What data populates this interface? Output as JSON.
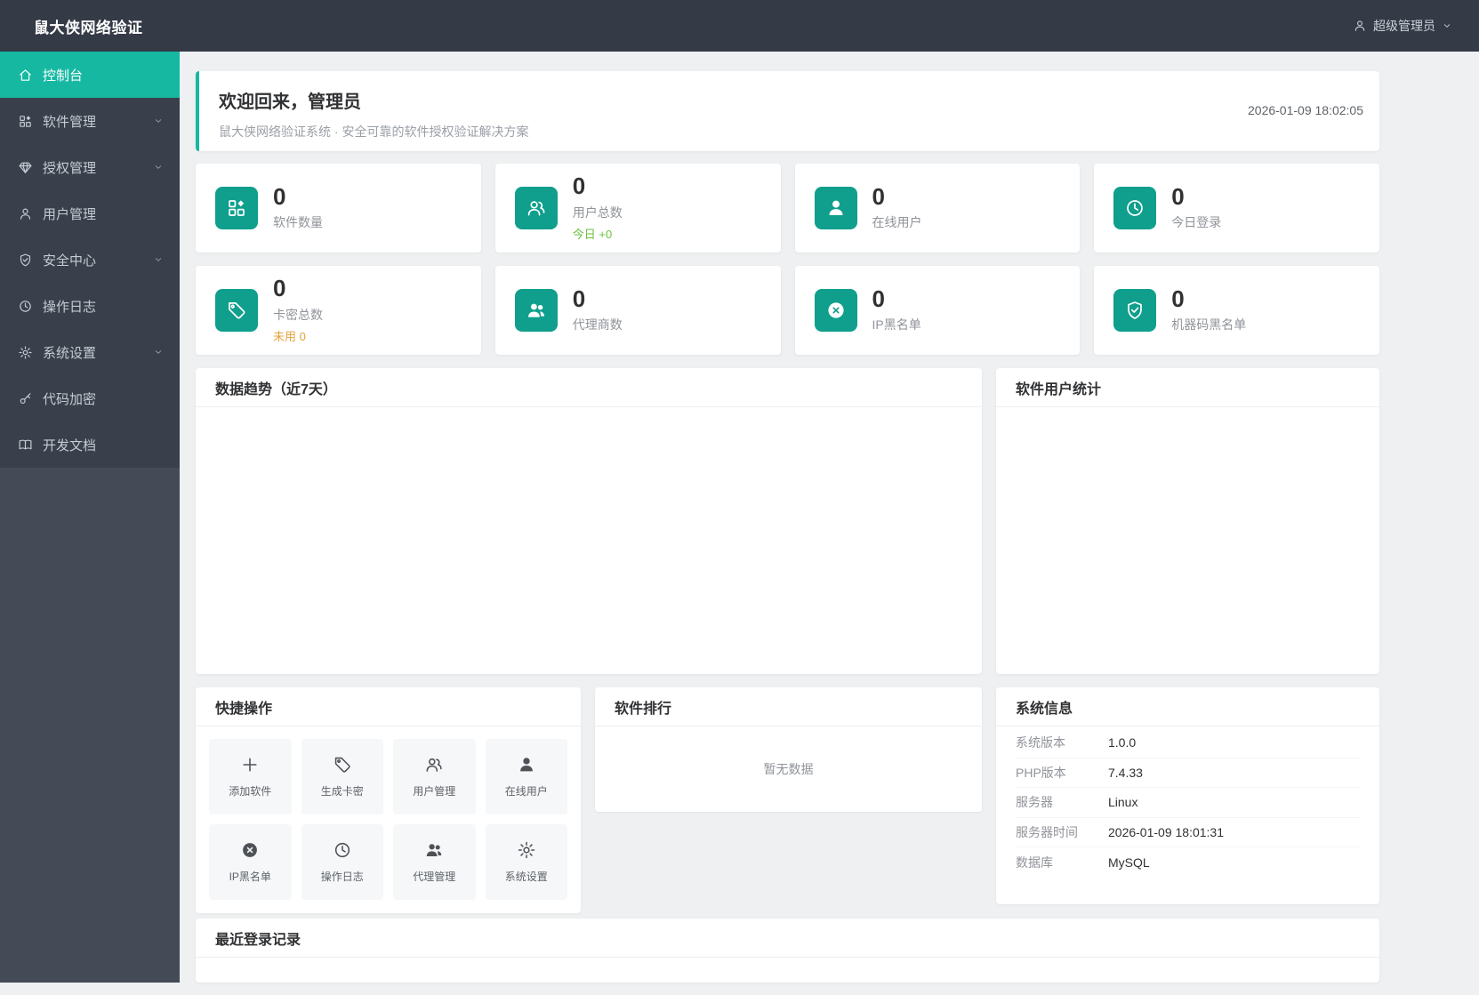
{
  "app": {
    "title": "鼠大侠网络验证"
  },
  "topbar": {
    "user": "超级管理员"
  },
  "colors": {
    "accent": "#16b8a2",
    "tile": "#0f9f8c",
    "success": "#67c23a",
    "warning": "#e6a23c",
    "topbar": "#343a46",
    "sidebar": "#39404b",
    "sidebar_lower": "#444a56"
  },
  "sidebar": {
    "items": [
      {
        "label": "控制台",
        "icon": "home",
        "active": true,
        "expandable": false
      },
      {
        "label": "软件管理",
        "icon": "apps",
        "active": false,
        "expandable": true
      },
      {
        "label": "授权管理",
        "icon": "diamond",
        "active": false,
        "expandable": true
      },
      {
        "label": "用户管理",
        "icon": "user",
        "active": false,
        "expandable": false
      },
      {
        "label": "安全中心",
        "icon": "shield-check",
        "active": false,
        "expandable": true
      },
      {
        "label": "操作日志",
        "icon": "clock",
        "active": false,
        "expandable": false
      },
      {
        "label": "系统设置",
        "icon": "gear",
        "active": false,
        "expandable": true
      },
      {
        "label": "代码加密",
        "icon": "key",
        "active": false,
        "expandable": false
      },
      {
        "label": "开发文档",
        "icon": "book",
        "active": false,
        "expandable": false
      }
    ]
  },
  "welcome": {
    "title": "欢迎回来，管理员",
    "subtitle": "鼠大侠网络验证系统 · 安全可靠的软件授权验证解决方案",
    "datetime": "2026-01-09 18:02:05"
  },
  "stats": [
    {
      "icon": "apps",
      "value": "0",
      "label": "软件数量"
    },
    {
      "icon": "users",
      "value": "0",
      "label": "用户总数",
      "sub": "今日 +0",
      "sub_type": "success"
    },
    {
      "icon": "user-solid",
      "value": "0",
      "label": "在线用户"
    },
    {
      "icon": "clock",
      "value": "0",
      "label": "今日登录"
    },
    {
      "icon": "tag",
      "value": "0",
      "label": "卡密总数",
      "sub": "未用 0",
      "sub_type": "warning"
    },
    {
      "icon": "users-solid",
      "value": "0",
      "label": "代理商数"
    },
    {
      "icon": "circle-x",
      "value": "0",
      "label": "IP黑名单"
    },
    {
      "icon": "shield-check",
      "value": "0",
      "label": "机器码黑名单"
    }
  ],
  "panels": {
    "trend": {
      "title": "数据趋势（近7天）"
    },
    "software_users": {
      "title": "软件用户统计"
    },
    "quick_actions": {
      "title": "快捷操作",
      "items": [
        {
          "icon": "plus",
          "label": "添加软件"
        },
        {
          "icon": "tag",
          "label": "生成卡密"
        },
        {
          "icon": "users",
          "label": "用户管理"
        },
        {
          "icon": "user-solid",
          "label": "在线用户"
        },
        {
          "icon": "circle-x",
          "label": "IP黑名单"
        },
        {
          "icon": "clock",
          "label": "操作日志"
        },
        {
          "icon": "users-solid",
          "label": "代理管理"
        },
        {
          "icon": "gear",
          "label": "系统设置"
        }
      ]
    },
    "ranking": {
      "title": "软件排行",
      "empty": "暂无数据"
    },
    "system_info": {
      "title": "系统信息",
      "rows": [
        {
          "label": "系统版本",
          "value": "1.0.0"
        },
        {
          "label": "PHP版本",
          "value": "7.4.33"
        },
        {
          "label": "服务器",
          "value": "Linux"
        },
        {
          "label": "服务器时间",
          "value": "2026-01-09 18:01:31"
        },
        {
          "label": "数据库",
          "value": "MySQL"
        }
      ]
    },
    "recent_logins": {
      "title": "最近登录记录"
    }
  }
}
